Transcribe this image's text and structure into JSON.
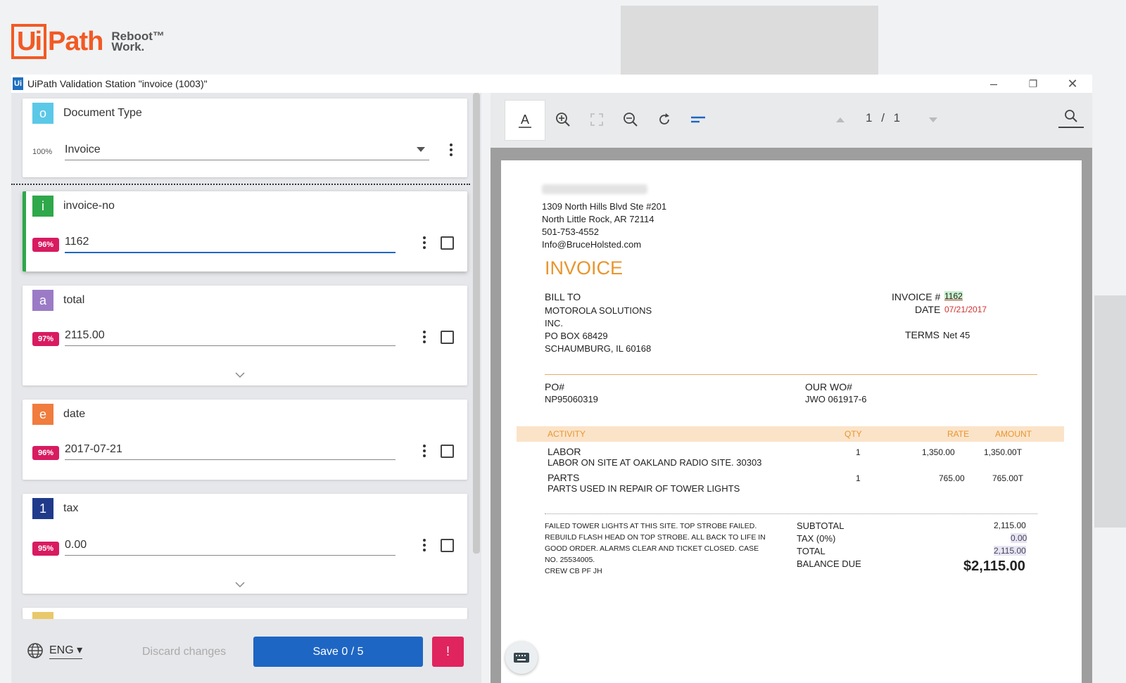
{
  "brand": {
    "logo_left": "Ui",
    "logo_right": "Path",
    "tagline_line1": "Reboot™",
    "tagline_line2": "Work."
  },
  "window": {
    "icon": "Ui",
    "title": "UiPath Validation Station \"invoice (1003)\"",
    "minimize": "–",
    "restore": "❐",
    "close": "✕"
  },
  "document_type": {
    "badge": "o",
    "badge_color": "#5bc8e8",
    "label": "Document Type",
    "confidence": "100%",
    "value": "Invoice"
  },
  "fields": [
    {
      "badge": "i",
      "badge_color": "#2ea84a",
      "label": "invoice-no",
      "confidence": "96%",
      "value": "1162"
    },
    {
      "badge": "a",
      "badge_color": "#9b7bc6",
      "label": "total",
      "confidence": "97%",
      "value": "2115.00"
    },
    {
      "badge": "e",
      "badge_color": "#f07c3e",
      "label": "date",
      "confidence": "96%",
      "value": "2017-07-21"
    },
    {
      "badge": "1",
      "badge_color": "#1f3a8a",
      "label": "tax",
      "confidence": "95%",
      "value": "0.00"
    }
  ],
  "footer": {
    "language": "ENG",
    "discard": "Discard changes",
    "save": "Save 0 / 5",
    "alert": "!"
  },
  "viewer": {
    "page_current": "1",
    "page_sep": "/",
    "page_total": "1"
  },
  "invoice": {
    "address1": "1309 North Hills Blvd Ste #201",
    "address2": "North Little Rock, AR  72114",
    "phone": "501-753-4552",
    "email": "Info@BruceHolsted.com",
    "heading": "INVOICE",
    "bill_to_label": "BILL TO",
    "bill_to_1": "MOTOROLA SOLUTIONS",
    "bill_to_2": "INC.",
    "bill_to_3": "PO BOX 68429",
    "bill_to_4": "SCHAUMBURG, IL  60168",
    "invoice_no_label": "INVOICE #",
    "invoice_no": "1162",
    "date_label": "DATE",
    "date": "07/21/2017",
    "terms_label": "TERMS",
    "terms": "Net 45",
    "po_label": "PO#",
    "po": "NP95060319",
    "wo_label": "OUR WO#",
    "wo": "JWO 061917-6",
    "columns": {
      "activity": "ACTIVITY",
      "qty": "QTY",
      "rate": "RATE",
      "amount": "AMOUNT"
    },
    "lines": [
      {
        "title": "LABOR",
        "desc": "LABOR ON SITE AT OAKLAND RADIO SITE. 30303",
        "qty": "1",
        "rate": "1,350.00",
        "amount": "1,350.00T"
      },
      {
        "title": "PARTS",
        "desc": "PARTS USED IN REPAIR OF TOWER LIGHTS",
        "qty": "1",
        "rate": "765.00",
        "amount": "765.00T"
      }
    ],
    "notes": [
      "FAILED TOWER LIGHTS AT THIS SITE.  TOP STROBE FAILED.",
      "REBUILD FLASH HEAD ON TOP STROBE.  ALL BACK TO LIFE IN",
      "GOOD ORDER.  ALARMS CLEAR AND TICKET CLOSED.  CASE",
      "NO. 25534005.",
      "CREW CB PF JH"
    ],
    "subtotal_label": "SUBTOTAL",
    "subtotal": "2,115.00",
    "tax_label": "TAX (0%)",
    "tax": "0.00",
    "total_label": "TOTAL",
    "total": "2,115.00",
    "balance_label": "BALANCE DUE",
    "balance": "$2,115.00"
  }
}
